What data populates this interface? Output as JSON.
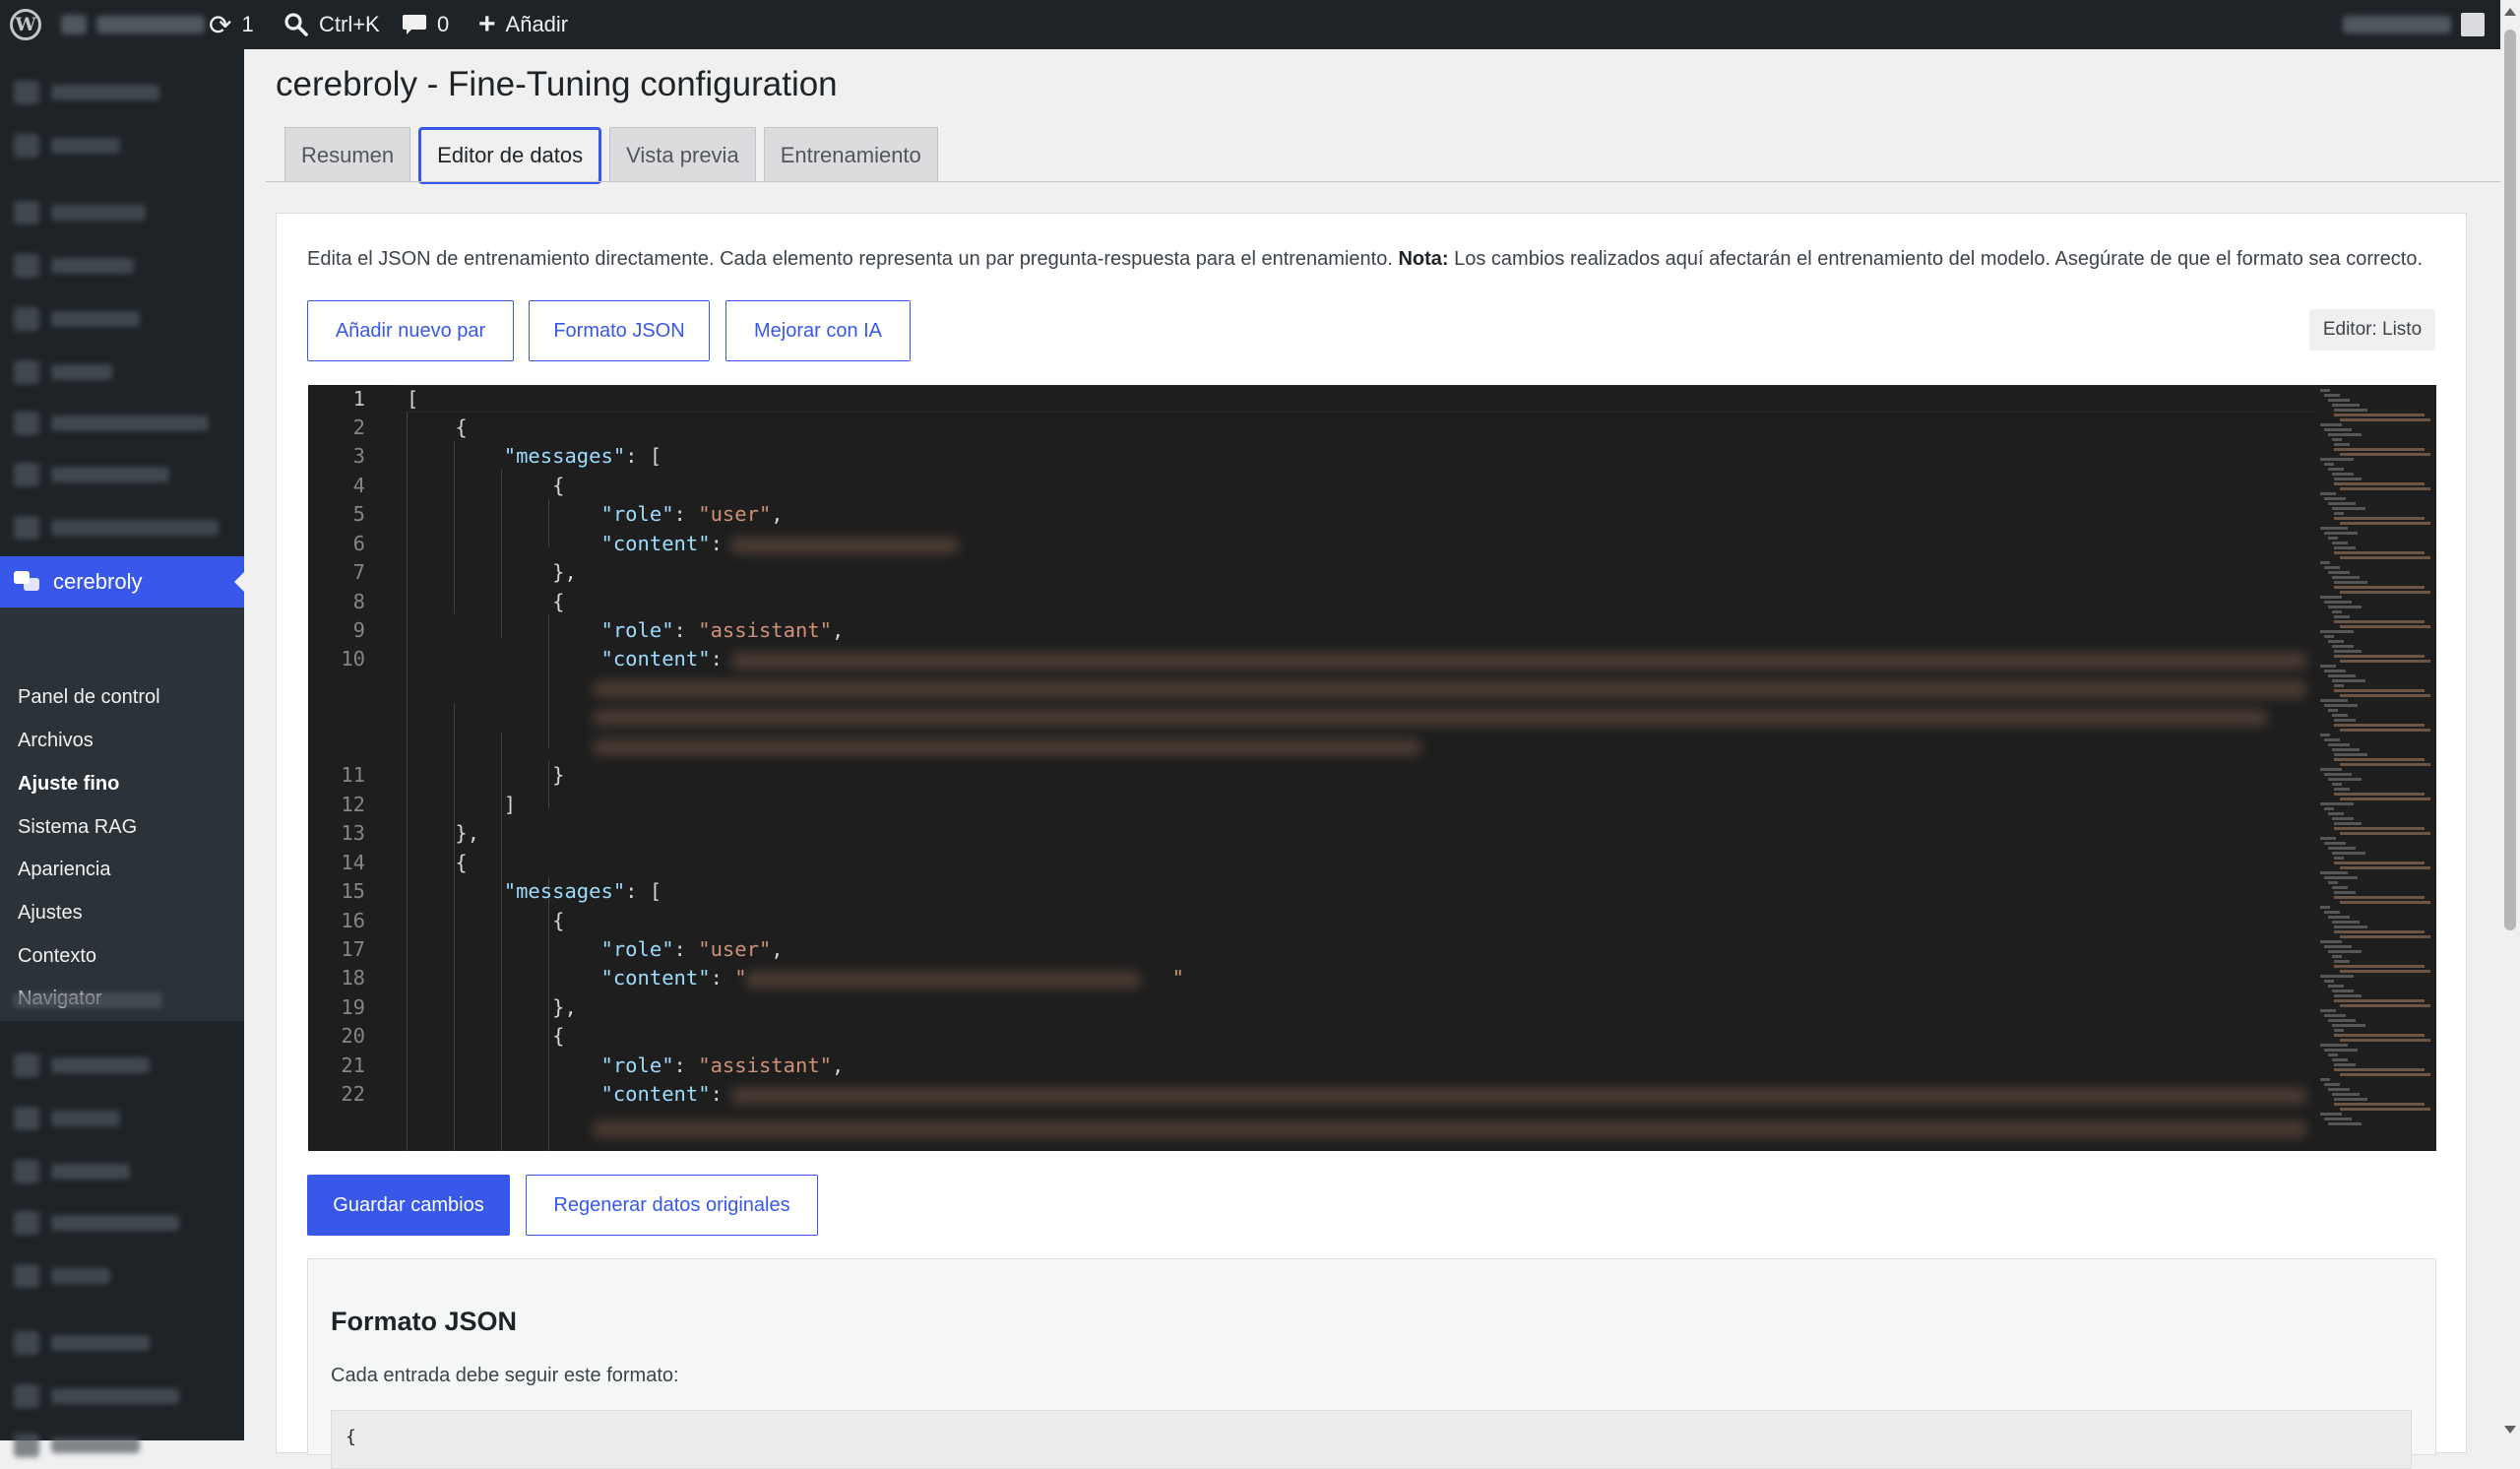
{
  "adminbar": {
    "updates_count": "1",
    "search_shortcut": "Ctrl+K",
    "comments_count": "0",
    "add_new_label": "Añadir"
  },
  "sidebar": {
    "current_plugin": "cerebroly",
    "submenu": [
      {
        "label": "Panel de control"
      },
      {
        "label": "Archivos"
      },
      {
        "label": "Ajuste fino"
      },
      {
        "label": "Sistema RAG"
      },
      {
        "label": "Apariencia"
      },
      {
        "label": "Ajustes"
      },
      {
        "label": "Contexto"
      },
      {
        "label": "Navigator"
      }
    ]
  },
  "page": {
    "title": "cerebroly - Fine-Tuning configuration",
    "tabs": [
      {
        "label": "Resumen"
      },
      {
        "label": "Editor de datos"
      },
      {
        "label": "Vista previa"
      },
      {
        "label": "Entrenamiento"
      }
    ],
    "description_text": "Edita el JSON de entrenamiento directamente. Cada elemento representa un par pregunta-respuesta para el entrenamiento.",
    "description_note_label": "Nota:",
    "description_note_text": "Los cambios realizados aquí afectarán el entrenamiento del modelo. Asegúrate de que el formato sea correcto.",
    "toolbar": {
      "add_pair": "Añadir nuevo par",
      "format_json": "Formato JSON",
      "improve_ai": "Mejorar con IA",
      "editor_status": "Editor: Listo"
    },
    "actions": {
      "save": "Guardar cambios",
      "regenerate": "Regenerar datos originales"
    },
    "format_section": {
      "title": "Formato JSON",
      "description": "Cada entrada debe seguir este formato:",
      "code_first_line": "{"
    }
  },
  "editor": {
    "lines": [
      {
        "n": "1",
        "c": "["
      },
      {
        "n": "2",
        "c": "    {"
      },
      {
        "n": "3",
        "c": "        \"messages\": ["
      },
      {
        "n": "4",
        "c": "            {"
      },
      {
        "n": "5",
        "c": "                \"role\": \"user\","
      },
      {
        "n": "6",
        "c": "                \"content\": "
      },
      {
        "n": "7",
        "c": "            },"
      },
      {
        "n": "8",
        "c": "            {"
      },
      {
        "n": "9",
        "c": "                \"role\": \"assistant\","
      },
      {
        "n": "10",
        "c": "                \"content\": "
      },
      {
        "n": "11",
        "c": "            }"
      },
      {
        "n": "12",
        "c": "        ]"
      },
      {
        "n": "13",
        "c": "    },"
      },
      {
        "n": "14",
        "c": "    {"
      },
      {
        "n": "15",
        "c": "        \"messages\": ["
      },
      {
        "n": "16",
        "c": "            {"
      },
      {
        "n": "17",
        "c": "                \"role\": \"user\","
      },
      {
        "n": "18",
        "c": "                \"content\": \"                                   \""
      },
      {
        "n": "19",
        "c": "            },"
      },
      {
        "n": "20",
        "c": "            {"
      },
      {
        "n": "21",
        "c": "                \"role\": \"assistant\","
      },
      {
        "n": "22",
        "c": "                \"content\": "
      }
    ]
  },
  "colors": {
    "accent": "#3858e9",
    "adminbar_bg": "#1d2327",
    "editor_bg": "#1e1e1e",
    "json_key": "#9cdcfe",
    "json_string": "#ce9178"
  }
}
